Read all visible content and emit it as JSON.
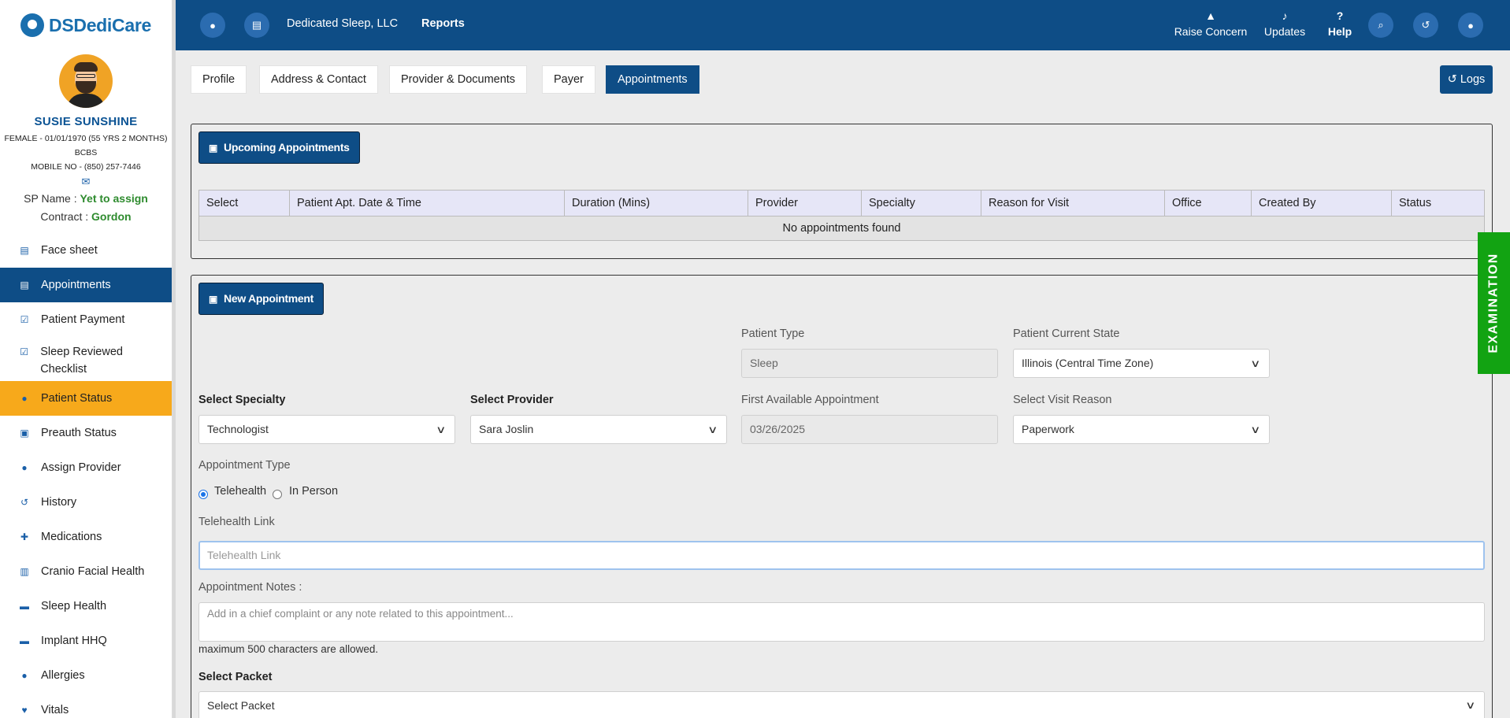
{
  "brand": {
    "name": "DSDediCare"
  },
  "patient": {
    "name": "SUSIE SUNSHINE",
    "demographics": "FEMALE - 01/01/1970 (55 YRS 2 MONTHS)",
    "insurance": "BCBS",
    "mobile": "MOBILE NO - (850) 257-7446",
    "sp_label": "SP Name :",
    "sp_value": "Yet to assign",
    "contract_label": "Contract :",
    "contract_value": "Gordon"
  },
  "sidebar": {
    "items": [
      {
        "label": "Face sheet",
        "icon": "document-icon"
      },
      {
        "label": "Appointments",
        "icon": "calendar-icon"
      },
      {
        "label": "Patient Payment",
        "icon": "checkbox-icon"
      },
      {
        "label": "Sleep Reviewed Checklist",
        "icon": "checkbox-icon"
      },
      {
        "label": "Patient Status",
        "icon": "user-icon"
      },
      {
        "label": "Preauth Status",
        "icon": "id-card-icon"
      },
      {
        "label": "Assign Provider",
        "icon": "user-icon"
      },
      {
        "label": "History",
        "icon": "history-icon"
      },
      {
        "label": "Medications",
        "icon": "plus-square-icon"
      },
      {
        "label": "Cranio Facial Health",
        "icon": "medkit-icon"
      },
      {
        "label": "Sleep Health",
        "icon": "bed-icon"
      },
      {
        "label": "Implant HHQ",
        "icon": "bed-icon"
      },
      {
        "label": "Allergies",
        "icon": "user-icon"
      },
      {
        "label": "Vitals",
        "icon": "heart-icon"
      }
    ]
  },
  "header": {
    "org_name": "Dedicated Sleep, LLC",
    "reports": "Reports",
    "raise_concern": "Raise Concern",
    "updates": "Updates",
    "help": "Help"
  },
  "tabs": [
    "Profile",
    "Address & Contact",
    "Provider & Documents",
    "Payer",
    "Appointments"
  ],
  "logs_label": "Logs",
  "upcoming": {
    "button": "Upcoming Appointments",
    "columns": [
      "Select",
      "Patient Apt. Date & Time",
      "Duration (Mins)",
      "Provider",
      "Specialty",
      "Reason for Visit",
      "Office",
      "Created By",
      "Status"
    ],
    "empty": "No appointments found"
  },
  "new_appointment": {
    "button": "New Appointment",
    "patient_type_label": "Patient Type",
    "patient_type_value": "Sleep",
    "current_state_label": "Patient Current State",
    "current_state_value": "Illinois (Central Time Zone)",
    "specialty_label": "Select Specialty",
    "specialty_value": "Technologist",
    "provider_label": "Select Provider",
    "provider_value": "Sara Joslin",
    "first_available_label": "First Available Appointment",
    "first_available_value": "03/26/2025",
    "visit_reason_label": "Select Visit Reason",
    "visit_reason_value": "Paperwork",
    "appt_type_label": "Appointment Type",
    "appt_type_options": [
      "Telehealth",
      "In Person"
    ],
    "appt_type_selected": "Telehealth",
    "telehealth_label": "Telehealth Link",
    "telehealth_placeholder": "Telehealth Link",
    "notes_label": "Appointment Notes :",
    "notes_placeholder": "Add in a chief complaint or any note related to this appointment...",
    "notes_hint": "maximum 500 characters are allowed.",
    "packet_label": "Select Packet",
    "packet_value": "Select Packet"
  },
  "examination_tab": "EXAMINATION",
  "colors": {
    "primary": "#0e4d86",
    "active_orange": "#f7a91b",
    "exam_green": "#12a312",
    "status_green": "#2e8b2e"
  }
}
